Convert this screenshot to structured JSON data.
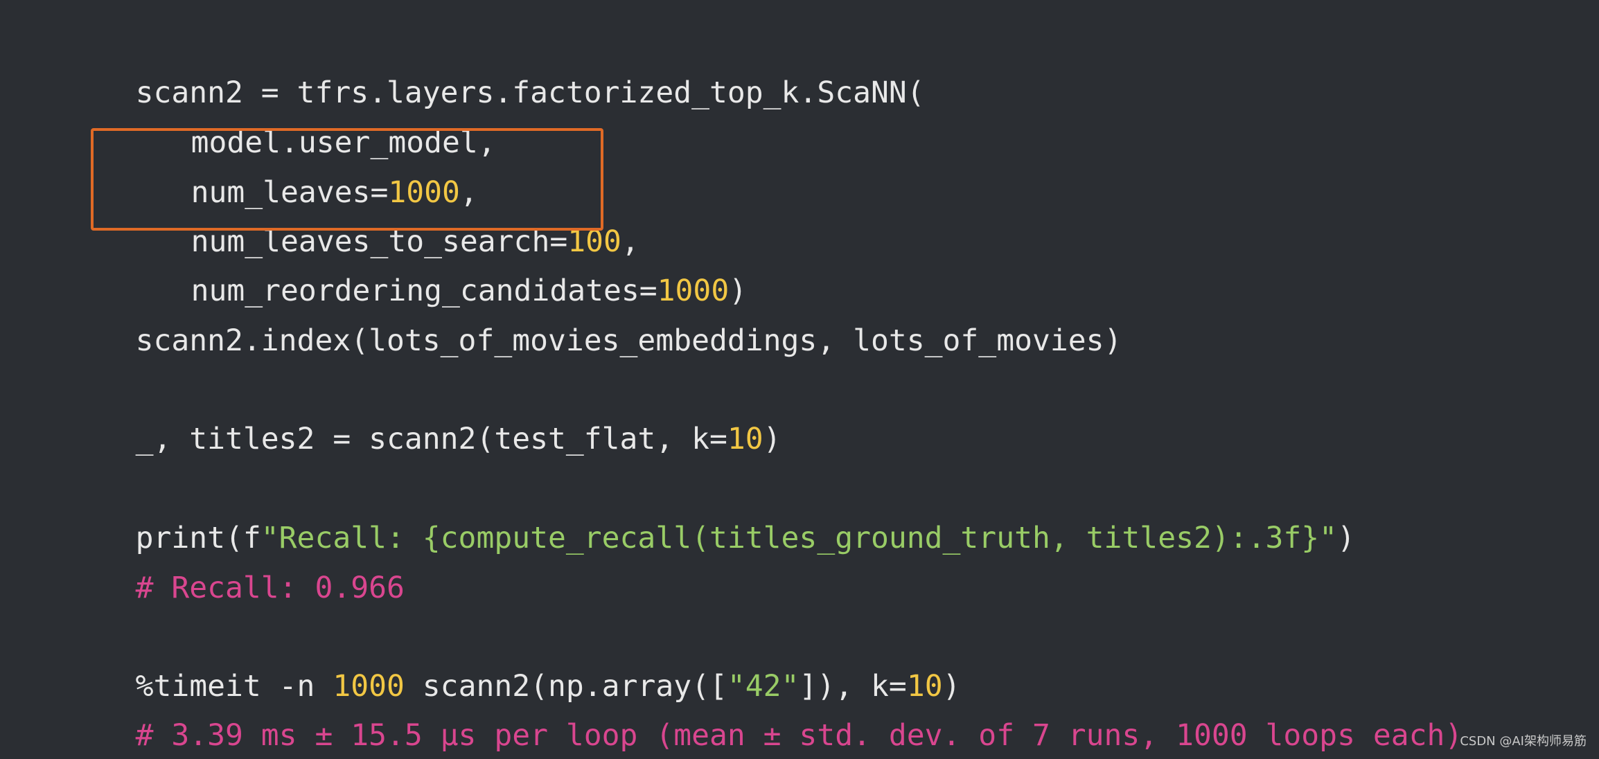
{
  "code": {
    "l1_a": "scann2 = tfrs.layers.factorized_top_k.ScaNN(",
    "l2_a": "model.user_model,",
    "l3_a": "num_leaves=",
    "l3_num": "1000",
    "l3_b": ",",
    "l4_a": "num_leaves_to_search=",
    "l4_num": "100",
    "l4_b": ",",
    "l5_a": "num_reordering_candidates=",
    "l5_num": "1000",
    "l5_b": ")",
    "l6_a": "scann2.index(lots_of_movies_embeddings, lots_of_movies)",
    "l7_a": "_, titles2 = scann2(test_flat, k=",
    "l7_num": "10",
    "l7_b": ")",
    "l8_a": "print(f",
    "l8_str": "\"Recall: {compute_recall(titles_ground_truth, titles2):.3f}\"",
    "l8_b": ")",
    "l9_comment": "# Recall: 0.966",
    "l10_a": "%timeit -n ",
    "l10_num1": "1000",
    "l10_b": " scann2(np.array([",
    "l10_str": "\"42\"",
    "l10_c": "]), k=",
    "l10_num2": "10",
    "l10_d": ")",
    "l11_comment": "# 3.39 ms ± 15.5 µs per loop (mean ± std. dev. of 7 runs, 1000 loops each)"
  },
  "watermark": "CSDN @AI架构师易筋",
  "colors": {
    "background": "#2b2e33",
    "default_text": "#e8e8e8",
    "number": "#f2c744",
    "string": "#99cc66",
    "comment": "#d9468f",
    "highlight_border": "#e06a26"
  }
}
